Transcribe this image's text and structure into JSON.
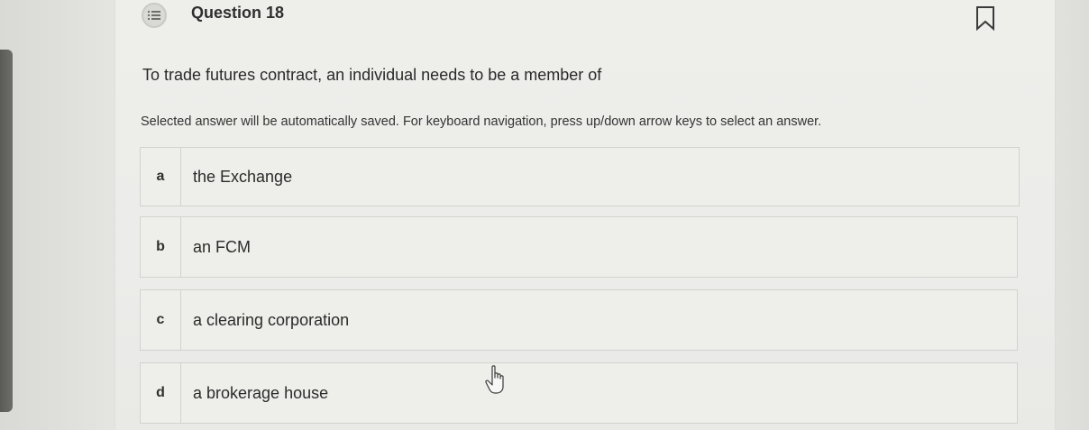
{
  "question": {
    "title": "Question 18",
    "prompt": "To trade futures contract, an individual needs to be a member of",
    "instructions": "Selected answer will be automatically saved. For keyboard navigation, press up/down arrow keys to select an answer."
  },
  "options": [
    {
      "letter": "a",
      "text": "the Exchange"
    },
    {
      "letter": "b",
      "text": "an FCM"
    },
    {
      "letter": "c",
      "text": "a clearing corporation"
    },
    {
      "letter": "d",
      "text": "a brokerage house"
    }
  ],
  "icons": {
    "header": "question-list-icon",
    "flag": "bookmark-icon",
    "pointer": "hand-pointer-icon"
  }
}
